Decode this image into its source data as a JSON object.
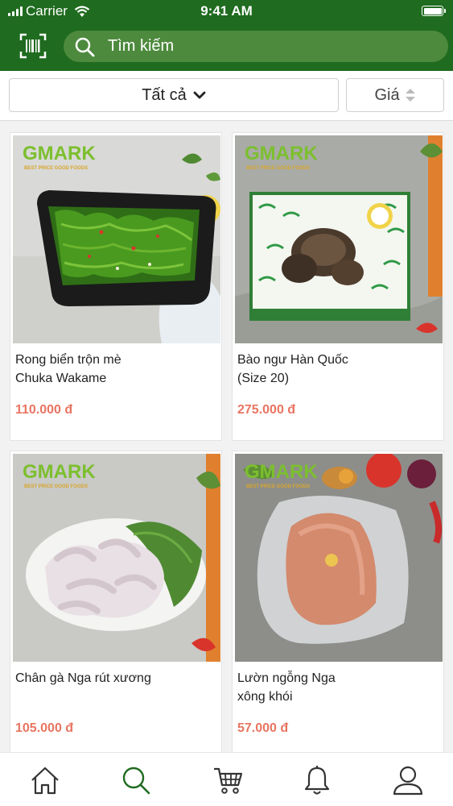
{
  "status_bar": {
    "carrier": "Carrier",
    "time": "9:41 AM"
  },
  "header": {
    "search_placeholder": "Tìm kiếm",
    "barcode_icon": "barcode-scan-icon",
    "search_icon": "search-icon",
    "brand_color": "#1f6b1f"
  },
  "filters": {
    "category_selected": "Tất cả",
    "sort_label": "Giá"
  },
  "products": [
    {
      "name": "Rong biển trộn mè\nChuka Wakame",
      "price": "110.000 đ",
      "logo": "GMARK",
      "tagline": "BEST PRICE GOOD FOODS"
    },
    {
      "name": "Bào ngư Hàn Quốc\n(Size 20)",
      "price": "275.000 đ",
      "logo": "GMARK",
      "tagline": "BEST PRICE GOOD FOODS"
    },
    {
      "name": "Chân gà Nga rút xương",
      "price": "105.000 đ",
      "logo": "GMARK",
      "tagline": "BEST PRICE GOOD FOODS"
    },
    {
      "name": "Lườn ngỗng Nga\n xông khói",
      "price": "57.000 đ",
      "logo": "GMARK",
      "tagline": "BEST PRICE GOOD FOODS"
    }
  ],
  "tab_bar": {
    "items": [
      {
        "icon": "home-icon",
        "active": false
      },
      {
        "icon": "search-icon",
        "active": true
      },
      {
        "icon": "cart-icon",
        "active": false
      },
      {
        "icon": "bell-icon",
        "active": false
      },
      {
        "icon": "user-icon",
        "active": false
      }
    ],
    "active_color": "#1f6b1f",
    "inactive_color": "#333333"
  },
  "price_color": "#e87561"
}
